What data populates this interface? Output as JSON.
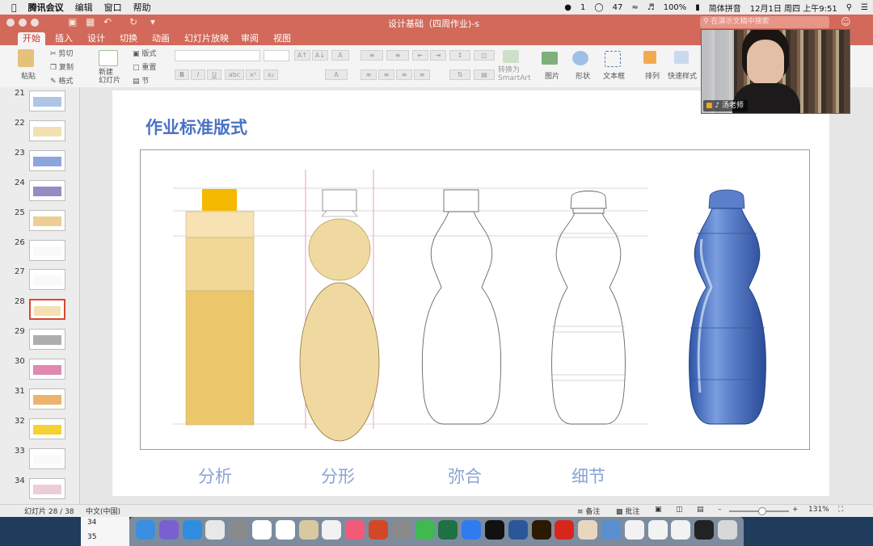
{
  "menubar": {
    "app_name": "腾讯会议",
    "items": [
      "编辑",
      "窗口",
      "帮助"
    ],
    "status": {
      "notif_count": "1",
      "wechat_count": "47",
      "battery": "100%",
      "input_method": "简体拼音",
      "datetime": "12月1日 周四 上午9:51"
    }
  },
  "window": {
    "doc_title": "设计基础（四周作业)-s",
    "search_placeholder": "在演示文稿中搜索"
  },
  "ribbon_tabs": [
    "开始",
    "插入",
    "设计",
    "切换",
    "动画",
    "幻灯片放映",
    "审阅",
    "视图"
  ],
  "ribbon": {
    "paste": "粘贴",
    "cut": "剪切",
    "copy": "复制",
    "format": "格式",
    "new_slide": "新建\n幻灯片",
    "layout": "版式",
    "reset": "重置",
    "section": "节",
    "convert_smartart": "转换为\nSmartArt",
    "picture": "图片",
    "shape": "形状",
    "textbox": "文本框",
    "arrange": "排列",
    "quick_styles": "快速样式"
  },
  "thumbnails": [
    {
      "num": "21"
    },
    {
      "num": "22"
    },
    {
      "num": "23"
    },
    {
      "num": "24"
    },
    {
      "num": "25"
    },
    {
      "num": "26"
    },
    {
      "num": "27"
    },
    {
      "num": "28"
    },
    {
      "num": "29"
    },
    {
      "num": "30"
    },
    {
      "num": "31"
    },
    {
      "num": "32"
    },
    {
      "num": "33"
    },
    {
      "num": "34"
    }
  ],
  "slide": {
    "title": "作业标准版式",
    "captions": [
      "分析",
      "分形",
      "弥合",
      "细节"
    ]
  },
  "video": {
    "participant_name": "汤老师"
  },
  "statusbar": {
    "slide_counter": "幻灯片 28 / 38",
    "language": "中文(中国)",
    "notes": "备注",
    "comments": "批注",
    "zoom": "131%"
  },
  "sheet_rows": [
    "34",
    "35"
  ],
  "colors": {
    "accent": "#d2695a",
    "title_blue": "#4a72c4",
    "caption_blue": "#8aa3d6",
    "bottle_fill": "#f0d9a0",
    "cap_yellow": "#f5b800",
    "bottle_blue": "#5b7fc8"
  }
}
